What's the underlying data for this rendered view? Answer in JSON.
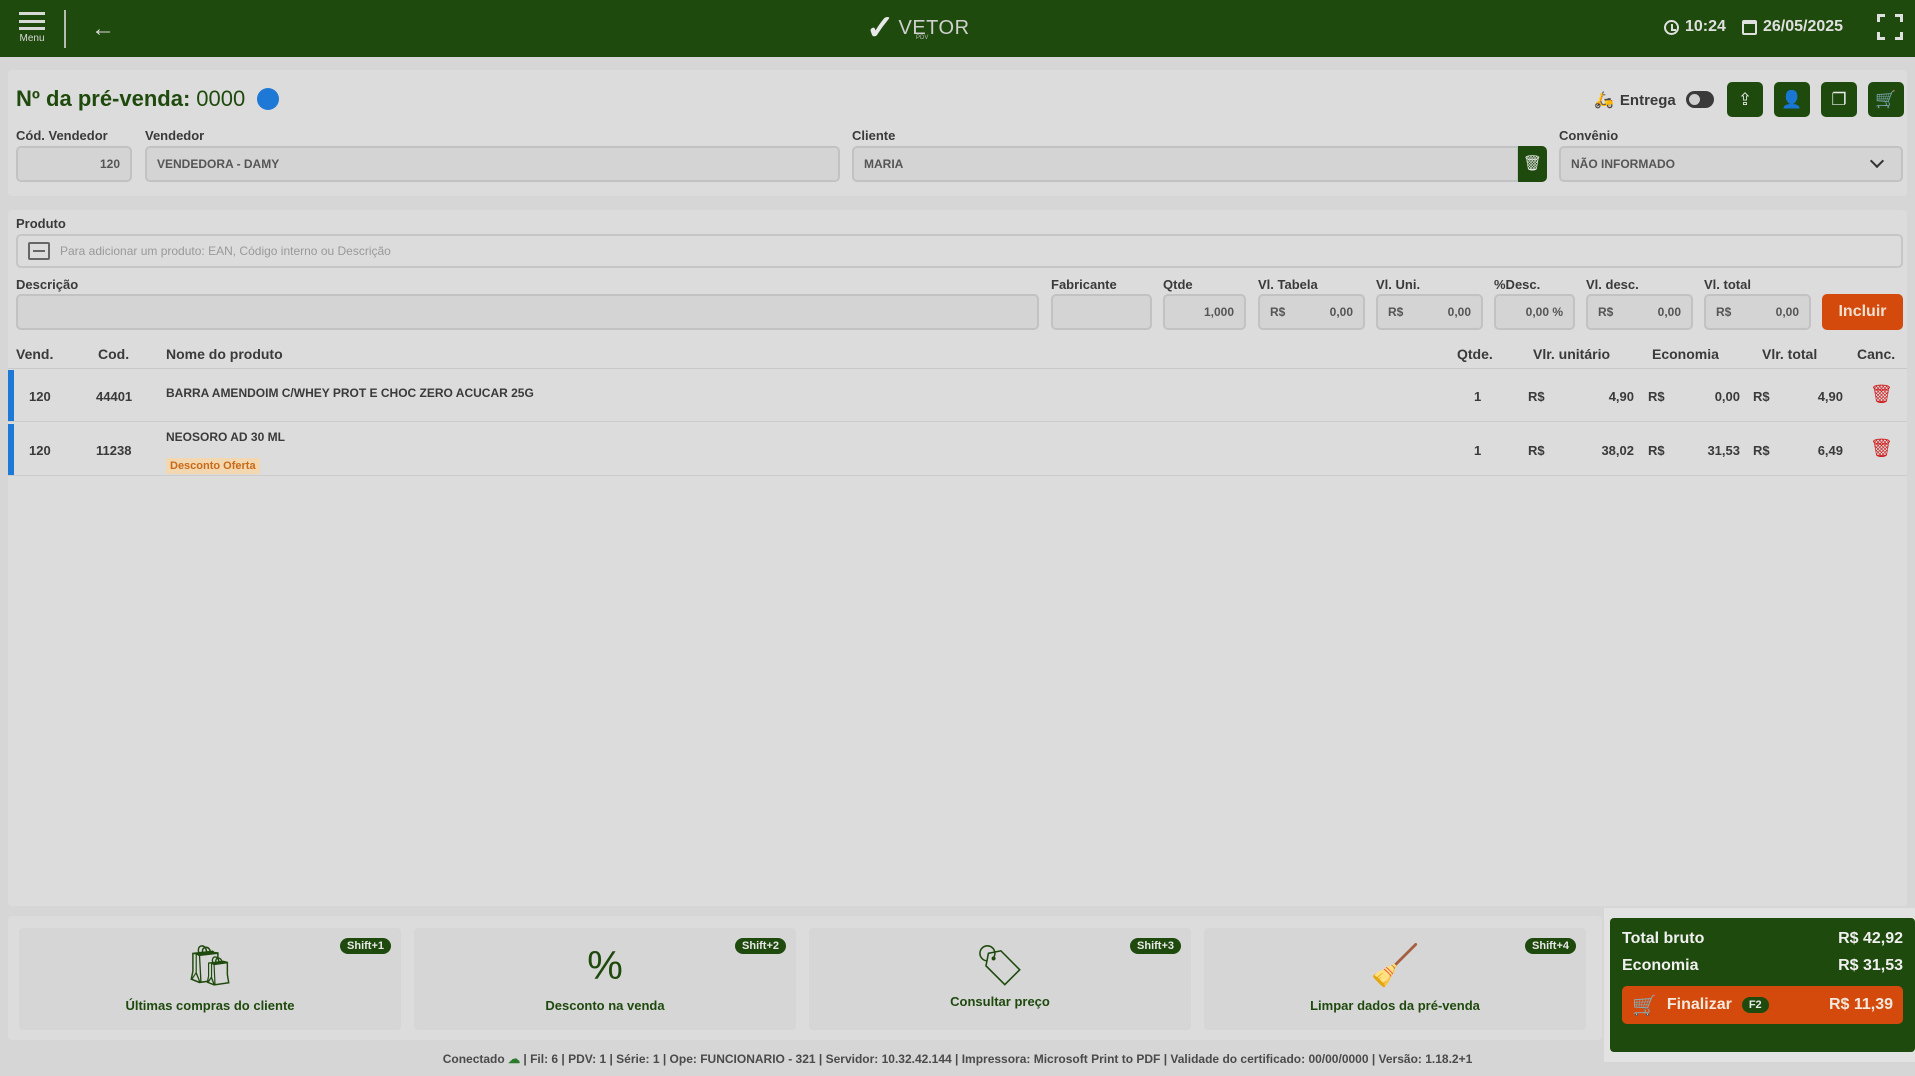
{
  "header": {
    "menu_label": "Menu",
    "brand": "VETOR",
    "brand_sub": "PDV",
    "time": "10:24",
    "date": "26/05/2025"
  },
  "presale": {
    "title": "Nº da pré-venda:",
    "number": "0000",
    "entrega_label": "Entrega"
  },
  "form": {
    "cod_vendedor_label": "Cód. Vendedor",
    "cod_vendedor": "120",
    "vendedor_label": "Vendedor",
    "vendedor": "VENDEDORA - DAMY",
    "cliente_label": "Cliente",
    "cliente": "MARIA",
    "convenio_label": "Convênio",
    "convenio": "NÃO INFORMADO"
  },
  "product": {
    "label": "Produto",
    "placeholder": "Para adicionar um produto: EAN, Código interno ou Descrição",
    "descricao_label": "Descrição",
    "fabricante_label": "Fabricante",
    "qtde_label": "Qtde",
    "qtde": "1,000",
    "vl_tabela_label": "Vl. Tabela",
    "vl_uni_label": "Vl. Uni.",
    "pct_desc_label": "%Desc.",
    "pct_desc": "0,00 %",
    "vl_desc_label": "Vl. desc.",
    "vl_total_label": "Vl. total",
    "currency": "R$",
    "zero": "0,00",
    "incluir": "Incluir"
  },
  "table": {
    "headers": [
      "Vend.",
      "Cod.",
      "Nome do produto",
      "Qtde.",
      "Vlr. unitário",
      "Economia",
      "Vlr. total",
      "Canc."
    ],
    "rows": [
      {
        "vend": "120",
        "cod": "44401",
        "nome": "BARRA AMENDOIM C/WHEY PROT E CHOC ZERO ACUCAR 25G",
        "tag": "",
        "qtde": "1",
        "unit": "4,90",
        "eco": "0,00",
        "total": "4,90"
      },
      {
        "vend": "120",
        "cod": "11238",
        "nome": "NEOSORO AD 30 ML",
        "tag": "Desconto Oferta",
        "qtde": "1",
        "unit": "38,02",
        "eco": "31,53",
        "total": "6,49"
      }
    ]
  },
  "actions": [
    {
      "label": "Últimas compras do cliente",
      "key": "Shift+1",
      "icon": "shopping-bag-clock-icon"
    },
    {
      "label": "Desconto na venda",
      "key": "Shift+2",
      "icon": "discount-badge-icon"
    },
    {
      "label": "Consultar preço",
      "key": "Shift+3",
      "icon": "price-tag-search-icon"
    },
    {
      "label": "Limpar dados da pré-venda",
      "key": "Shift+4",
      "icon": "broom-icon"
    }
  ],
  "totals": {
    "bruto_label": "Total bruto",
    "bruto": "R$ 42,92",
    "economia_label": "Economia",
    "economia": "R$ 31,53",
    "finalizar": "Finalizar",
    "finalizar_key": "F2",
    "finalizar_value": "R$ 11,39"
  },
  "status": {
    "conectado": "Conectado",
    "info": "| Fil: 6 | PDV: 1 | Série: 1 | Ope: FUNCIONARIO - 321 | Servidor: 10.32.42.144 | Impressora: Microsoft Print to PDF | Validade do certificado: 00/00/0000 | Versão: 1.18.2+1"
  },
  "colors": {
    "primary": "#1f4a0d",
    "accent": "#d34a0c",
    "status_dot": "#1e78d6",
    "delete": "#d01e1e"
  }
}
